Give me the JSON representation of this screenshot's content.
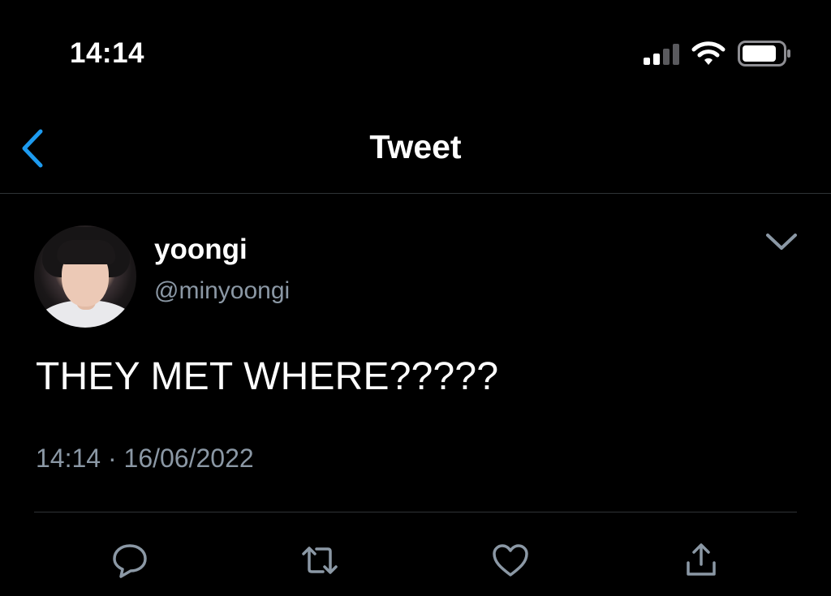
{
  "status_bar": {
    "time": "14:14"
  },
  "header": {
    "title": "Tweet"
  },
  "tweet": {
    "display_name": "yoongi",
    "handle": "@minyoongi",
    "text": "THEY MET WHERE?????",
    "time": "14:14",
    "separator": "·",
    "date": "16/06/2022"
  },
  "icons": {
    "back": "chevron-left-icon",
    "more": "chevron-down-icon",
    "reply": "reply-icon",
    "retweet": "retweet-icon",
    "like": "heart-icon",
    "share": "share-icon"
  },
  "colors": {
    "background": "#000000",
    "accent": "#1d9bf0",
    "text": "#ffffff",
    "secondary_text": "#8b98a5",
    "divider": "#2f3336"
  }
}
